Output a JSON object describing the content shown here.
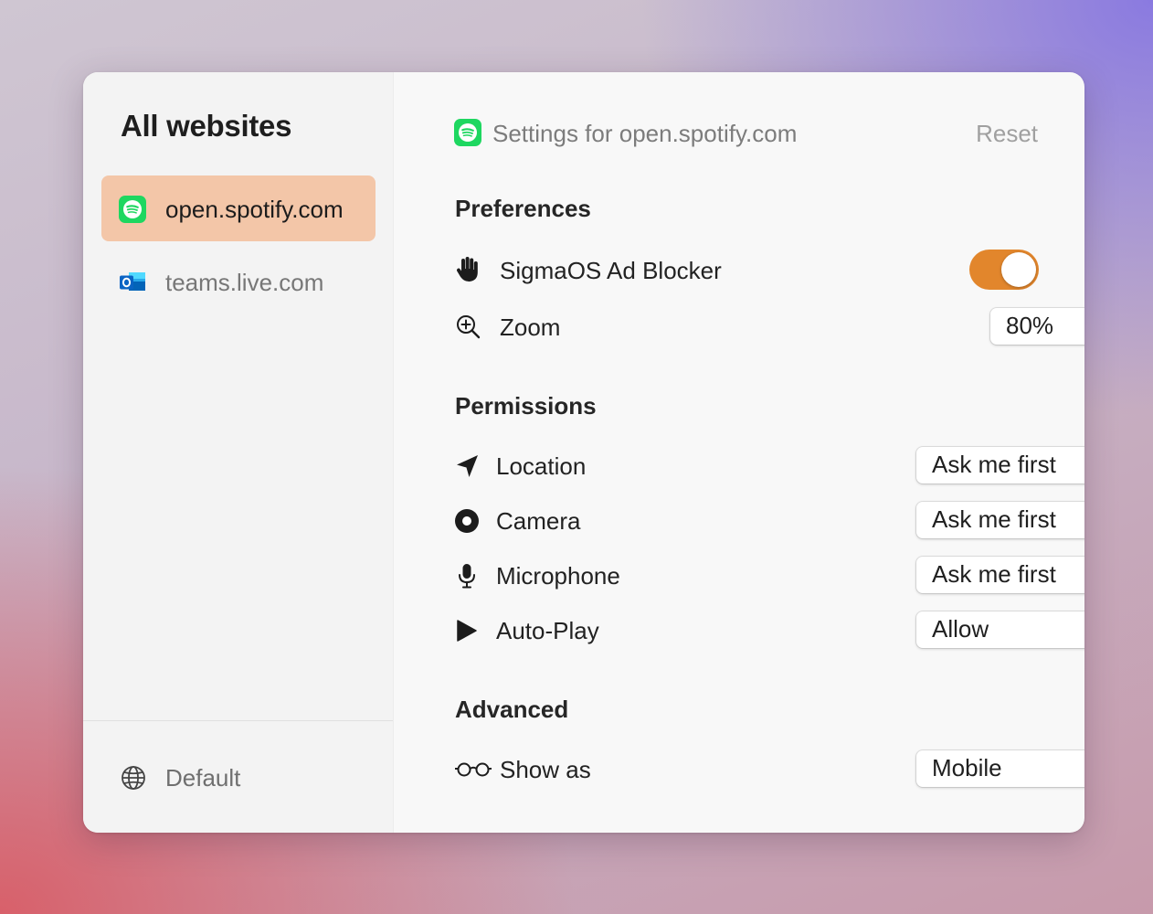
{
  "sidebar": {
    "title": "All websites",
    "items": [
      {
        "label": "open.spotify.com",
        "icon": "spotify-icon",
        "active": true
      },
      {
        "label": "teams.live.com",
        "icon": "outlook-icon",
        "active": false
      }
    ],
    "footer": {
      "label": "Default",
      "icon": "globe-icon"
    }
  },
  "header": {
    "title": "Settings for open.spotify.com",
    "icon": "spotify-icon",
    "reset_label": "Reset"
  },
  "sections": {
    "preferences": {
      "title": "Preferences",
      "ad_blocker": {
        "label": "SigmaOS Ad Blocker",
        "icon": "hand-icon",
        "enabled": true
      },
      "zoom": {
        "label": "Zoom",
        "icon": "zoom-in-icon",
        "value": "80%"
      }
    },
    "permissions": {
      "title": "Permissions",
      "location": {
        "label": "Location",
        "icon": "location-arrow-icon",
        "value": "Ask me first"
      },
      "camera": {
        "label": "Camera",
        "icon": "camera-icon",
        "value": "Ask me first"
      },
      "microphone": {
        "label": "Microphone",
        "icon": "microphone-icon",
        "value": "Ask me first"
      },
      "autoplay": {
        "label": "Auto-Play",
        "icon": "play-icon",
        "value": "Allow"
      }
    },
    "advanced": {
      "title": "Advanced",
      "show_as": {
        "label": "Show as",
        "icon": "glasses-icon",
        "value": "Mobile"
      }
    }
  },
  "colors": {
    "accent": "#e2862c",
    "selection": "#f3c6a8",
    "spotify": "#1ed760",
    "outlook": "#0a64c4"
  }
}
